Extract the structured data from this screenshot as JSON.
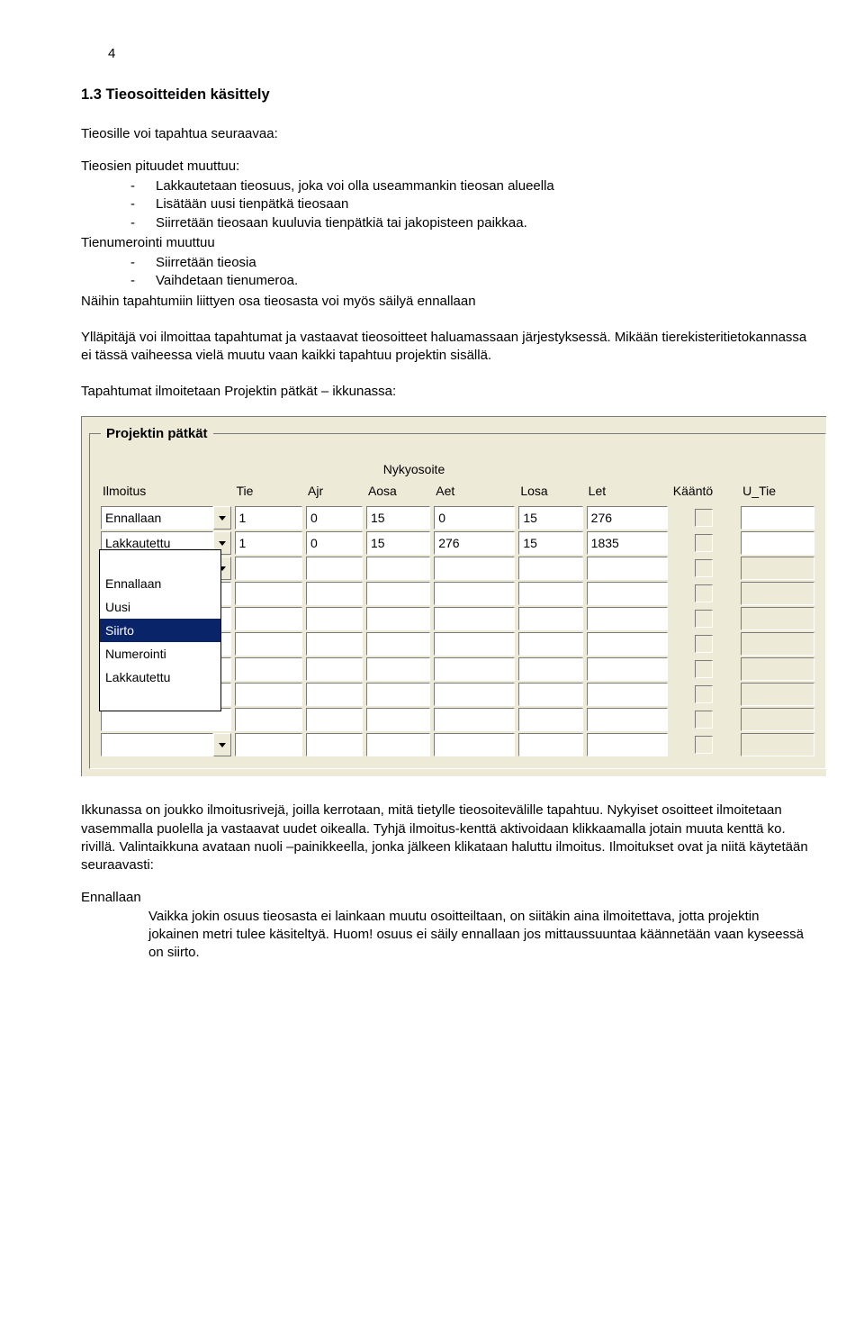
{
  "page_number": "4",
  "heading": "1.3 Tieosoitteiden käsittely",
  "p_intro": "Tieosille voi tapahtua seuraavaa:",
  "group1_title": "Tieosien pituudet muuttuu:",
  "group1_items": [
    "Lakkautetaan tieosuus, joka voi olla useammankin tieosan alueella",
    "Lisätään uusi tienpätkä tieosaan",
    "Siirretään tieosaan kuuluvia tienpätkiä tai jakopisteen paikkaa."
  ],
  "group2_title": "Tienumerointi muuttuu",
  "group2_items": [
    "Siirretään tieosia",
    "Vaihdetaan tienumeroa."
  ],
  "p_after_lists": "Näihin tapahtumiin liittyen osa tieosasta voi myös säilyä ennallaan",
  "p_para2": "Ylläpitäjä voi ilmoittaa tapahtumat ja vastaavat tieosoitteet haluamassaan järjestyksessä. Mikään tierekisteritietokannassa ei tässä vaiheessa vielä muutu vaan kaikki tapahtuu projektin sisällä.",
  "p_para3": "Tapahtumat ilmoitetaan Projektin pätkät – ikkunassa:",
  "form": {
    "legend": "Projektin pätkät",
    "subheader": "Nykyosoite",
    "cols": [
      "Ilmoitus",
      "Tie",
      "Ajr",
      "Aosa",
      "Aet",
      "Losa",
      "Let",
      "Kääntö",
      "U_Tie"
    ],
    "rows": [
      {
        "ilmoitus": "Ennallaan",
        "tie": "1",
        "ajr": "0",
        "aosa": "15",
        "aet": "0",
        "losa": "15",
        "let": "276",
        "kaanto": false,
        "utie": ""
      },
      {
        "ilmoitus": "Lakkautettu",
        "tie": "1",
        "ajr": "0",
        "aosa": "15",
        "aet": "276",
        "losa": "15",
        "let": "1835",
        "kaanto": false,
        "utie": ""
      }
    ],
    "blank_rows": 8,
    "dropdown_options": [
      "",
      "Ennallaan",
      "Uusi",
      "Siirto",
      "Numerointi",
      "Lakkautettu",
      ""
    ],
    "dropdown_selected": "Siirto"
  },
  "p_after_shot": "Ikkunassa on joukko ilmoitusrivejä, joilla kerrotaan, mitä tietylle tieosoitevälille tapahtuu. Nykyiset osoitteet ilmoitetaan vasemmalla puolella ja vastaavat uudet oikealla. Tyhjä ilmoitus-kenttä aktivoidaan klikkaamalla jotain muuta kenttä ko. rivillä. Valintaikkuna avataan nuoli –painikkeella, jonka jälkeen klikataan haluttu ilmoitus. Ilmoitukset ovat ja niitä käytetään seuraavasti:",
  "def_term": "Ennallaan",
  "def_body": "Vaikka jokin osuus tieosasta ei lainkaan muutu osoitteiltaan, on siitäkin aina ilmoitettava, jotta projektin jokainen metri tulee käsiteltyä. Huom! osuus ei säily ennallaan jos mittaussuuntaa käännetään vaan kyseessä on siirto."
}
